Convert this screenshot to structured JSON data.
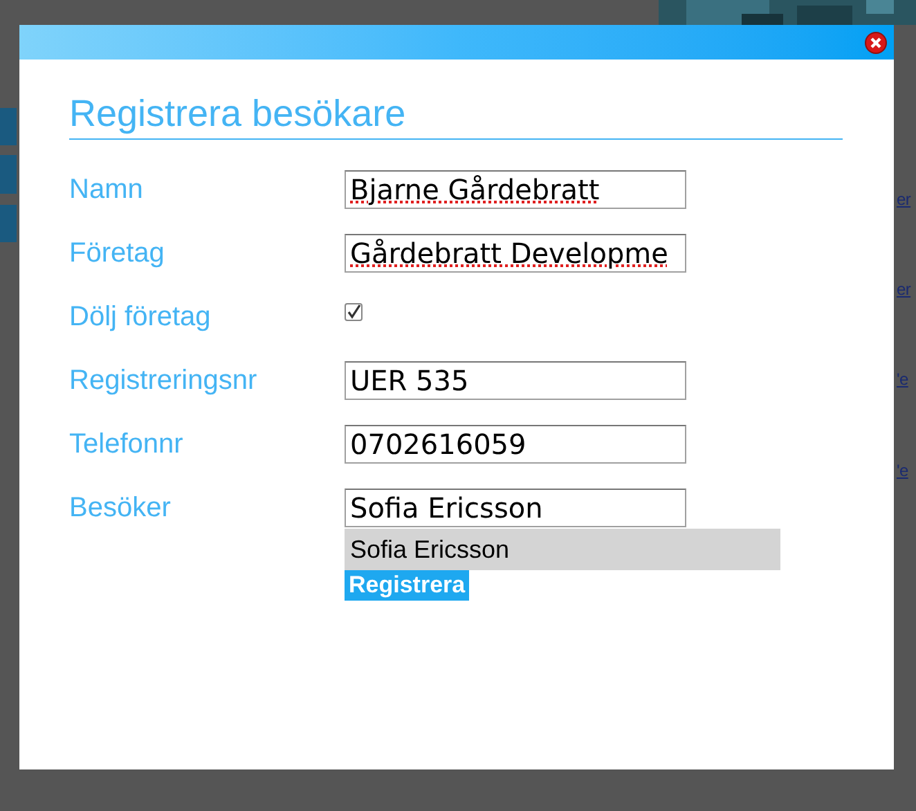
{
  "background": {
    "links": [
      "er",
      "er",
      "'e",
      "'e"
    ]
  },
  "dialog": {
    "title": "Registrera besökare",
    "fields": [
      {
        "kind": "text",
        "label": "Namn",
        "value": "Bjarne Gårdebratt",
        "spellcheck_marked": true
      },
      {
        "kind": "text",
        "label": "Företag",
        "value": "Gårdebratt Developme",
        "spellcheck_marked": true
      },
      {
        "kind": "checkbox",
        "label": "Dölj företag",
        "checked": true
      },
      {
        "kind": "text",
        "label": "Registreringsnr",
        "value": "UER 535",
        "spellcheck_marked": false
      },
      {
        "kind": "text",
        "label": "Telefonnr",
        "value": "0702616059",
        "spellcheck_marked": false
      },
      {
        "kind": "text",
        "label": "Besöker",
        "value": "Sofia Ericsson",
        "spellcheck_marked": false
      }
    ],
    "suggestions": [
      "Sofia Ericsson"
    ],
    "submit_button": "Registrera"
  }
}
